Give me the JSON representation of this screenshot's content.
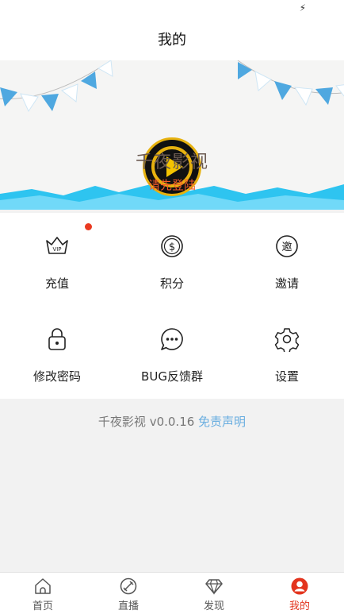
{
  "status_bar": {
    "icon": "charging-icon",
    "glyph": "⚡"
  },
  "header": {
    "title": "我的"
  },
  "banner": {
    "app_name": "千夜影视",
    "login_prompt": "请先登陆",
    "logo": "play-logo-icon"
  },
  "grid": {
    "items": [
      {
        "label": "充值",
        "icon": "vip-crown-icon",
        "badge": true
      },
      {
        "label": "积分",
        "icon": "coin-icon",
        "badge": false
      },
      {
        "label": "邀请",
        "icon": "invite-icon",
        "badge": false
      },
      {
        "label": "修改密码",
        "icon": "lock-icon",
        "badge": false
      },
      {
        "label": "BUG反馈群",
        "icon": "chat-bubble-icon",
        "badge": false
      },
      {
        "label": "设置",
        "icon": "gear-icon",
        "badge": false
      }
    ],
    "invite_glyph": "邀"
  },
  "footer": {
    "version_text": "千夜影视 v0.0.16 ",
    "disclaimer": "免责声明"
  },
  "bottom_nav": {
    "active": "我的",
    "items": [
      {
        "label": "首页",
        "icon": "home-icon"
      },
      {
        "label": "直播",
        "icon": "live-icon"
      },
      {
        "label": "发现",
        "icon": "diamond-icon"
      },
      {
        "label": "我的",
        "icon": "profile-icon"
      }
    ]
  },
  "colors": {
    "accent_red": "#e3341e",
    "login_orange": "#f2592a",
    "link_blue": "#6aaee0",
    "logo_gold": "#e7b20f",
    "banner_blue": "#2ec4f0"
  }
}
